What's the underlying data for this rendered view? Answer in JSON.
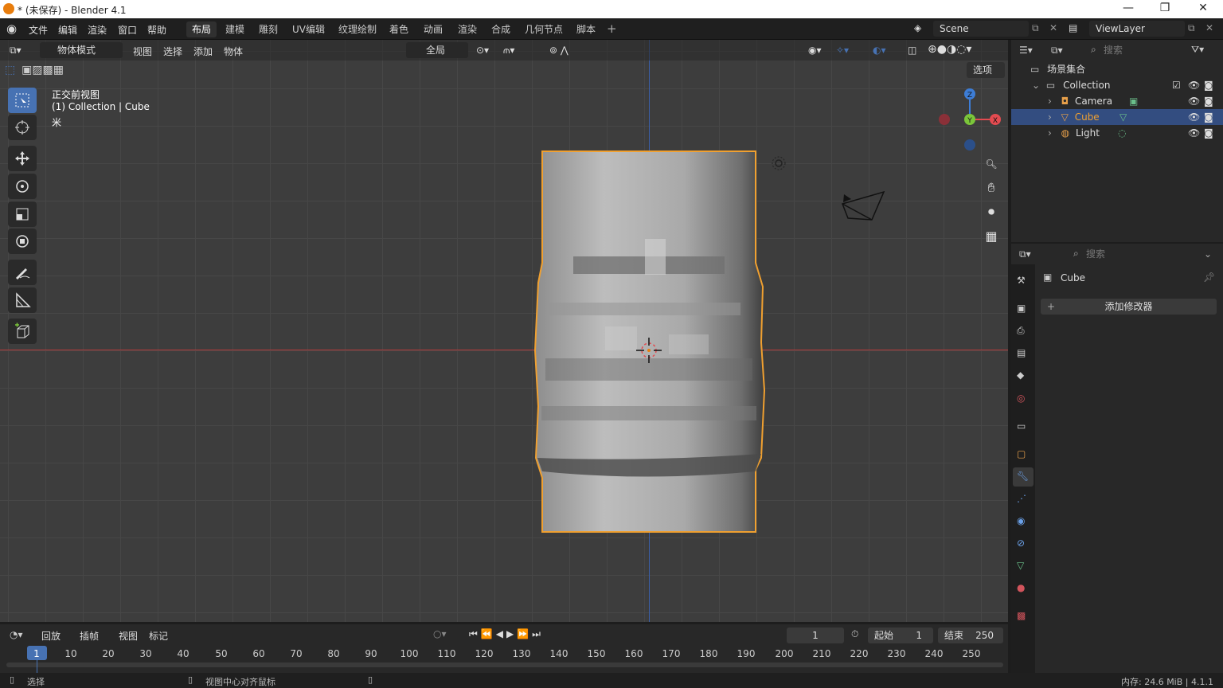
{
  "window": {
    "title": "* (未保存) - Blender 4.1",
    "controls": [
      "—",
      "❐",
      "✕"
    ]
  },
  "menus": [
    "文件",
    "编辑",
    "渲染",
    "窗口",
    "帮助"
  ],
  "workspaces": [
    "布局",
    "建模",
    "雕刻",
    "UV编辑",
    "纹理绘制",
    "着色",
    "动画",
    "渲染",
    "合成",
    "几何节点",
    "脚本"
  ],
  "active_workspace": "布局",
  "scene": {
    "name": "Scene",
    "view_layer": "ViewLayer"
  },
  "viewport": {
    "mode": "物体模式",
    "menu": [
      "视图",
      "选择",
      "添加",
      "物体"
    ],
    "transform_orientation": "全局",
    "options_label": "选项",
    "overlay_text": {
      "view_name": "正交前视图",
      "collection": "(1) Collection | Cube",
      "unit": "米"
    },
    "gizmo": {
      "z": "Z",
      "y": "Y",
      "x": "X"
    }
  },
  "outliner": {
    "search_placeholder": "搜索",
    "scene_collection": "场景集合",
    "collection": "Collection",
    "items": [
      {
        "name": "Camera",
        "selected": false
      },
      {
        "name": "Cube",
        "selected": true
      },
      {
        "name": "Light",
        "selected": false
      }
    ]
  },
  "properties": {
    "search_placeholder": "搜索",
    "object_name": "Cube",
    "add_modifier": "添加修改器"
  },
  "timeline": {
    "menu": [
      "回放",
      "插帧",
      "视图",
      "标记"
    ],
    "current_frame": "1",
    "start_label": "起始",
    "start": "1",
    "end_label": "结束",
    "end": "250",
    "ticks": [
      "1",
      "10",
      "20",
      "30",
      "40",
      "50",
      "60",
      "70",
      "80",
      "90",
      "100",
      "110",
      "120",
      "130",
      "140",
      "150",
      "160",
      "170",
      "180",
      "190",
      "200",
      "210",
      "220",
      "230",
      "240",
      "250"
    ]
  },
  "status": {
    "left": "选择",
    "middle": "视图中心对齐鼠标",
    "right": "内存: 24.6 MiB | 4.1.1"
  },
  "colors": {
    "accent": "#4772b3",
    "selection": "#e87d0d",
    "x_axis": "#e34b50",
    "y_axis": "#7bc63a",
    "z_axis": "#3d7dd6"
  }
}
